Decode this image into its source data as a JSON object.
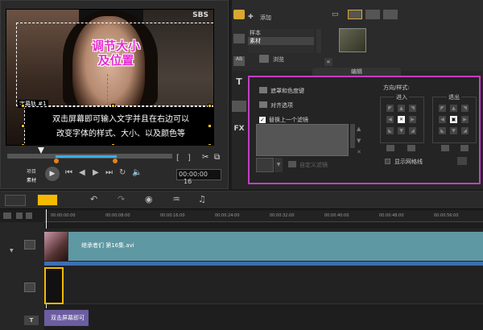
{
  "preview": {
    "watermark": "SBS",
    "track_label": "字幕轨 #1",
    "hint_line1": "调节大小",
    "hint_line2": "及位置",
    "caption_line1": "双击屏幕即可输入文字并且在右边可以",
    "caption_line2": "改变字体的样式、大小、以及颜色等",
    "mode_project": "项目",
    "mode_clip": "素材",
    "timecode": "00:00:00",
    "timecode_frame": "16"
  },
  "library": {
    "add_label": "添加",
    "list_items": [
      "样本",
      "素材"
    ],
    "browse_label": "浏览",
    "edit_tab": "编辑"
  },
  "options": {
    "mask_label": "遮罩和色度键",
    "align_label": "对齐选项",
    "replace_label": "替换上一个滤镜",
    "custom_filter": "自定义滤镜",
    "direction_label": "方向/样式:",
    "in_label": "进入",
    "out_label": "退出",
    "grid_label": "显示网格线"
  },
  "timeline": {
    "ticks": [
      "00:00:00:00",
      "00:00:08:00",
      "00:00:16:00",
      "00:00:24:00",
      "00:00:32:00",
      "00:00:40:00",
      "00:00:48:00",
      "00:00:56:00"
    ],
    "video_clip_label": "继承者们 第16集.avi",
    "title_clip_label": "双击屏幕即可"
  },
  "colors": {
    "accent_magenta": "#c23fc2",
    "selection_yellow": "#f5b900",
    "video_clip": "#5e98a3",
    "title_clip": "#6b5da0"
  }
}
